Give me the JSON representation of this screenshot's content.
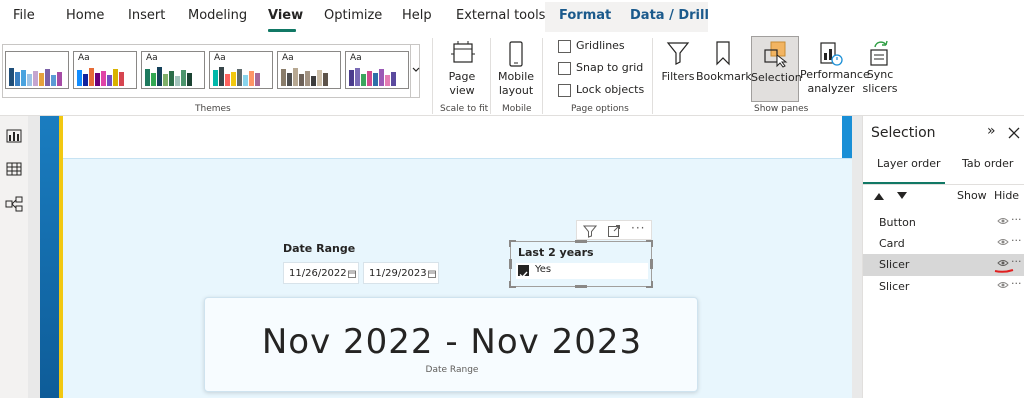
{
  "menu": {
    "items": [
      "File",
      "Home",
      "Insert",
      "Modeling",
      "View",
      "Optimize",
      "Help",
      "External tools",
      "Format",
      "Data / Drill"
    ],
    "active": "View"
  },
  "ribbon": {
    "groups": {
      "themes": "Themes",
      "scale": "Scale to fit",
      "mobile": "Mobile",
      "page_options": "Page options",
      "show_panes": "Show panes"
    },
    "theme_tile_text": "Aa",
    "page_view_label": "Page view",
    "mobile_layout_label": "Mobile layout",
    "checkboxes": [
      "Gridlines",
      "Snap to grid",
      "Lock objects"
    ],
    "panes": [
      "Filters",
      "Bookmarks",
      "Selection",
      "Performance analyzer",
      "Sync slicers"
    ],
    "accent": "#117865"
  },
  "canvas": {
    "date_slicer": {
      "title": "Date Range",
      "start": "11/26/2022",
      "end": "11/29/2023"
    },
    "toggle_slicer": {
      "title": "Last 2 years",
      "option": "Yes",
      "checked": true
    },
    "card": {
      "value": "Nov 2022 - Nov 2023",
      "label": "Date Range"
    }
  },
  "selection_pane": {
    "title": "Selection",
    "tabs": [
      "Layer order",
      "Tab order"
    ],
    "show_label": "Show",
    "hide_label": "Hide",
    "layers": [
      "Button",
      "Card",
      "Slicer",
      "Slicer"
    ],
    "selected_layer_index": 2
  }
}
